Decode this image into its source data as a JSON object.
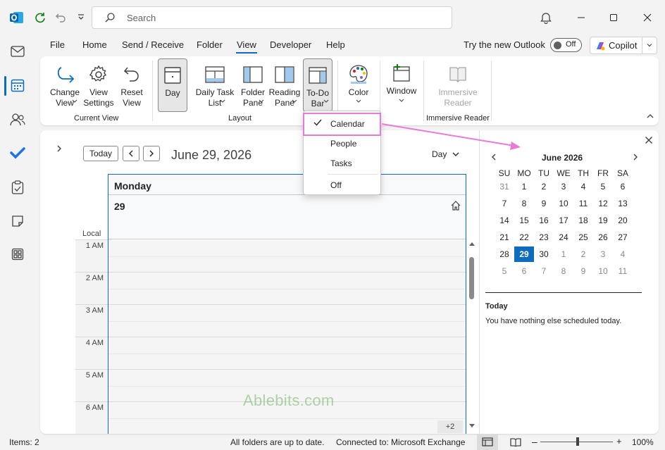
{
  "titlebar": {
    "search_placeholder": "Search"
  },
  "menu": {
    "tabs": [
      "File",
      "Home",
      "Send / Receive",
      "Folder",
      "View",
      "Developer",
      "Help"
    ],
    "active": "View",
    "try_new": "Try the new Outlook",
    "toggle": "Off",
    "copilot": "Copilot"
  },
  "ribbon": {
    "current_view": {
      "change_view": "Change\nView",
      "view_settings": "View\nSettings",
      "reset_view": "Reset\nView",
      "group": "Current View"
    },
    "layout": {
      "day": "Day",
      "daily_task_list": "Daily Task\nList",
      "folder_pane": "Folder\nPane",
      "reading_pane": "Reading\nPane",
      "todo_bar": "To-Do\nBar",
      "group": "Layout"
    },
    "color": "Color",
    "window": "Window",
    "immersive": {
      "label": "Immersive\nReader",
      "group": "Immersive Reader"
    }
  },
  "dropdown": {
    "items": [
      "Calendar",
      "People",
      "Tasks",
      "Off"
    ],
    "checked": "Calendar"
  },
  "calendar": {
    "today_btn": "Today",
    "title": "June 29, 2026",
    "view_mode": "Day",
    "weekday": "Monday",
    "day_number": "29",
    "local_label": "Local",
    "hours": [
      "1 AM",
      "2 AM",
      "3 AM",
      "4 AM",
      "5 AM",
      "6 AM"
    ],
    "more_badge": "+2"
  },
  "todo": {
    "month": "June 2026",
    "weekdays": [
      "SU",
      "MO",
      "TU",
      "WE",
      "TH",
      "FR",
      "SA"
    ],
    "weeks": [
      [
        "31",
        "1",
        "2",
        "3",
        "4",
        "5",
        "6"
      ],
      [
        "7",
        "8",
        "9",
        "10",
        "11",
        "12",
        "13"
      ],
      [
        "14",
        "15",
        "16",
        "17",
        "18",
        "19",
        "20"
      ],
      [
        "21",
        "22",
        "23",
        "24",
        "25",
        "26",
        "27"
      ],
      [
        "28",
        "29",
        "30",
        "1",
        "2",
        "3",
        "4"
      ],
      [
        "5",
        "6",
        "7",
        "8",
        "9",
        "10",
        "11"
      ]
    ],
    "today_heading": "Today",
    "today_message": "You have nothing else scheduled today."
  },
  "status": {
    "items": "Items: 2",
    "folders": "All folders are up to date.",
    "connection": "Connected to: Microsoft Exchange",
    "zoom": "100%"
  },
  "watermark": "Ablebits.com",
  "colors": {
    "accent": "#0f6cbd",
    "highlight": "#e87bd8"
  }
}
